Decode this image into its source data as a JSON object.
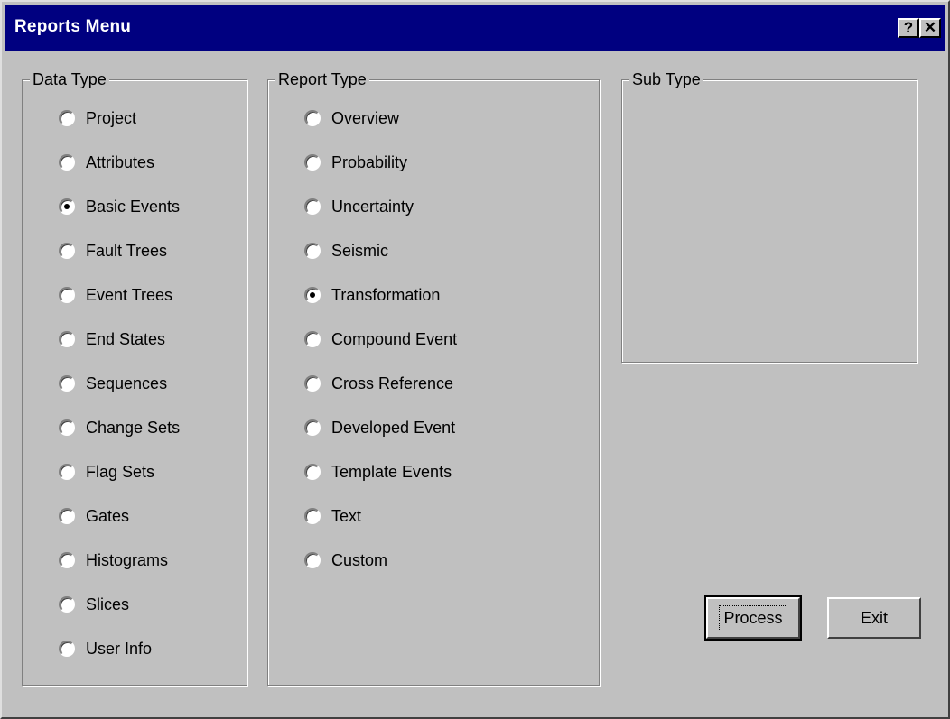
{
  "window": {
    "title": "Reports Menu",
    "help_glyph": "?",
    "close_glyph": "✕"
  },
  "data_type": {
    "label": "Data Type",
    "selected": "Basic Events",
    "options": [
      "Project",
      "Attributes",
      "Basic Events",
      "Fault Trees",
      "Event Trees",
      "End States",
      "Sequences",
      "Change Sets",
      "Flag Sets",
      "Gates",
      "Histograms",
      "Slices",
      "User Info"
    ]
  },
  "report_type": {
    "label": "Report Type",
    "selected": "Transformation",
    "options": [
      "Overview",
      "Probability",
      "Uncertainty",
      "Seismic",
      "Transformation",
      "Compound Event",
      "Cross Reference",
      "Developed Event",
      "Template Events",
      "Text",
      "Custom"
    ]
  },
  "sub_type": {
    "label": "Sub Type"
  },
  "buttons": {
    "process": "Process",
    "exit": "Exit"
  },
  "colors": {
    "title_bar": "#000080",
    "face": "#c0c0c0"
  },
  "icons": {
    "help": "help-icon",
    "close": "close-icon"
  }
}
